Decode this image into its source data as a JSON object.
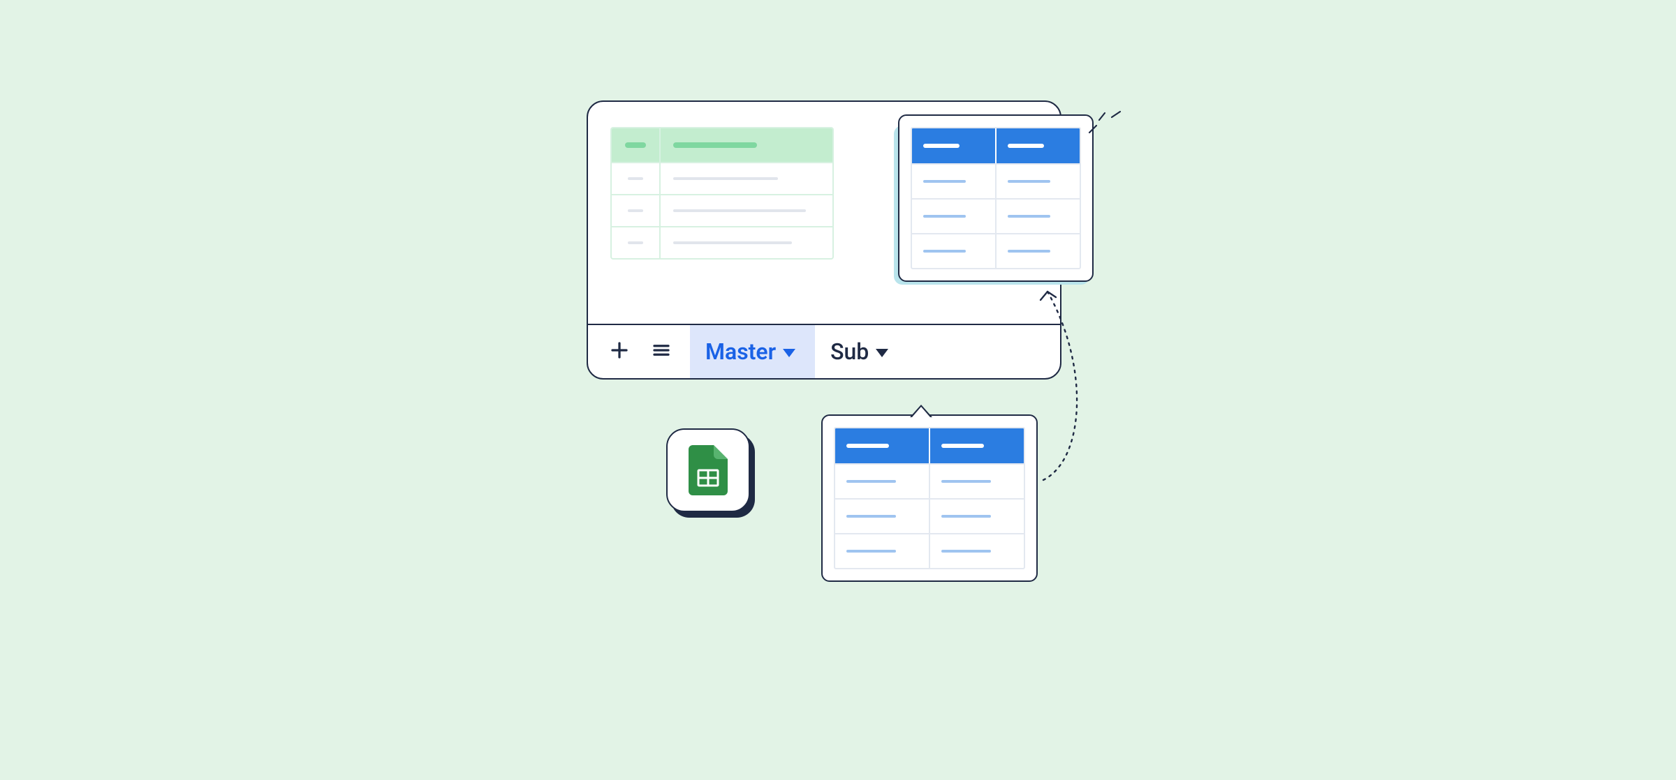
{
  "tabs": {
    "master": "Master",
    "sub": "Sub"
  },
  "colors": {
    "background": "#e2f3e6",
    "accent_blue": "#2b7de1",
    "accent_mint": "#c3edcf",
    "ink": "#1f2a44",
    "tab_active_bg": "#dde6fb",
    "tab_active_text": "#1a62e6",
    "sheets_icon": "#2f8f46"
  },
  "icons": {
    "add_sheet": "plus-icon",
    "all_sheets": "menu-icon",
    "tab_dropdown": "caret-down-icon",
    "app": "google-sheets-icon"
  }
}
